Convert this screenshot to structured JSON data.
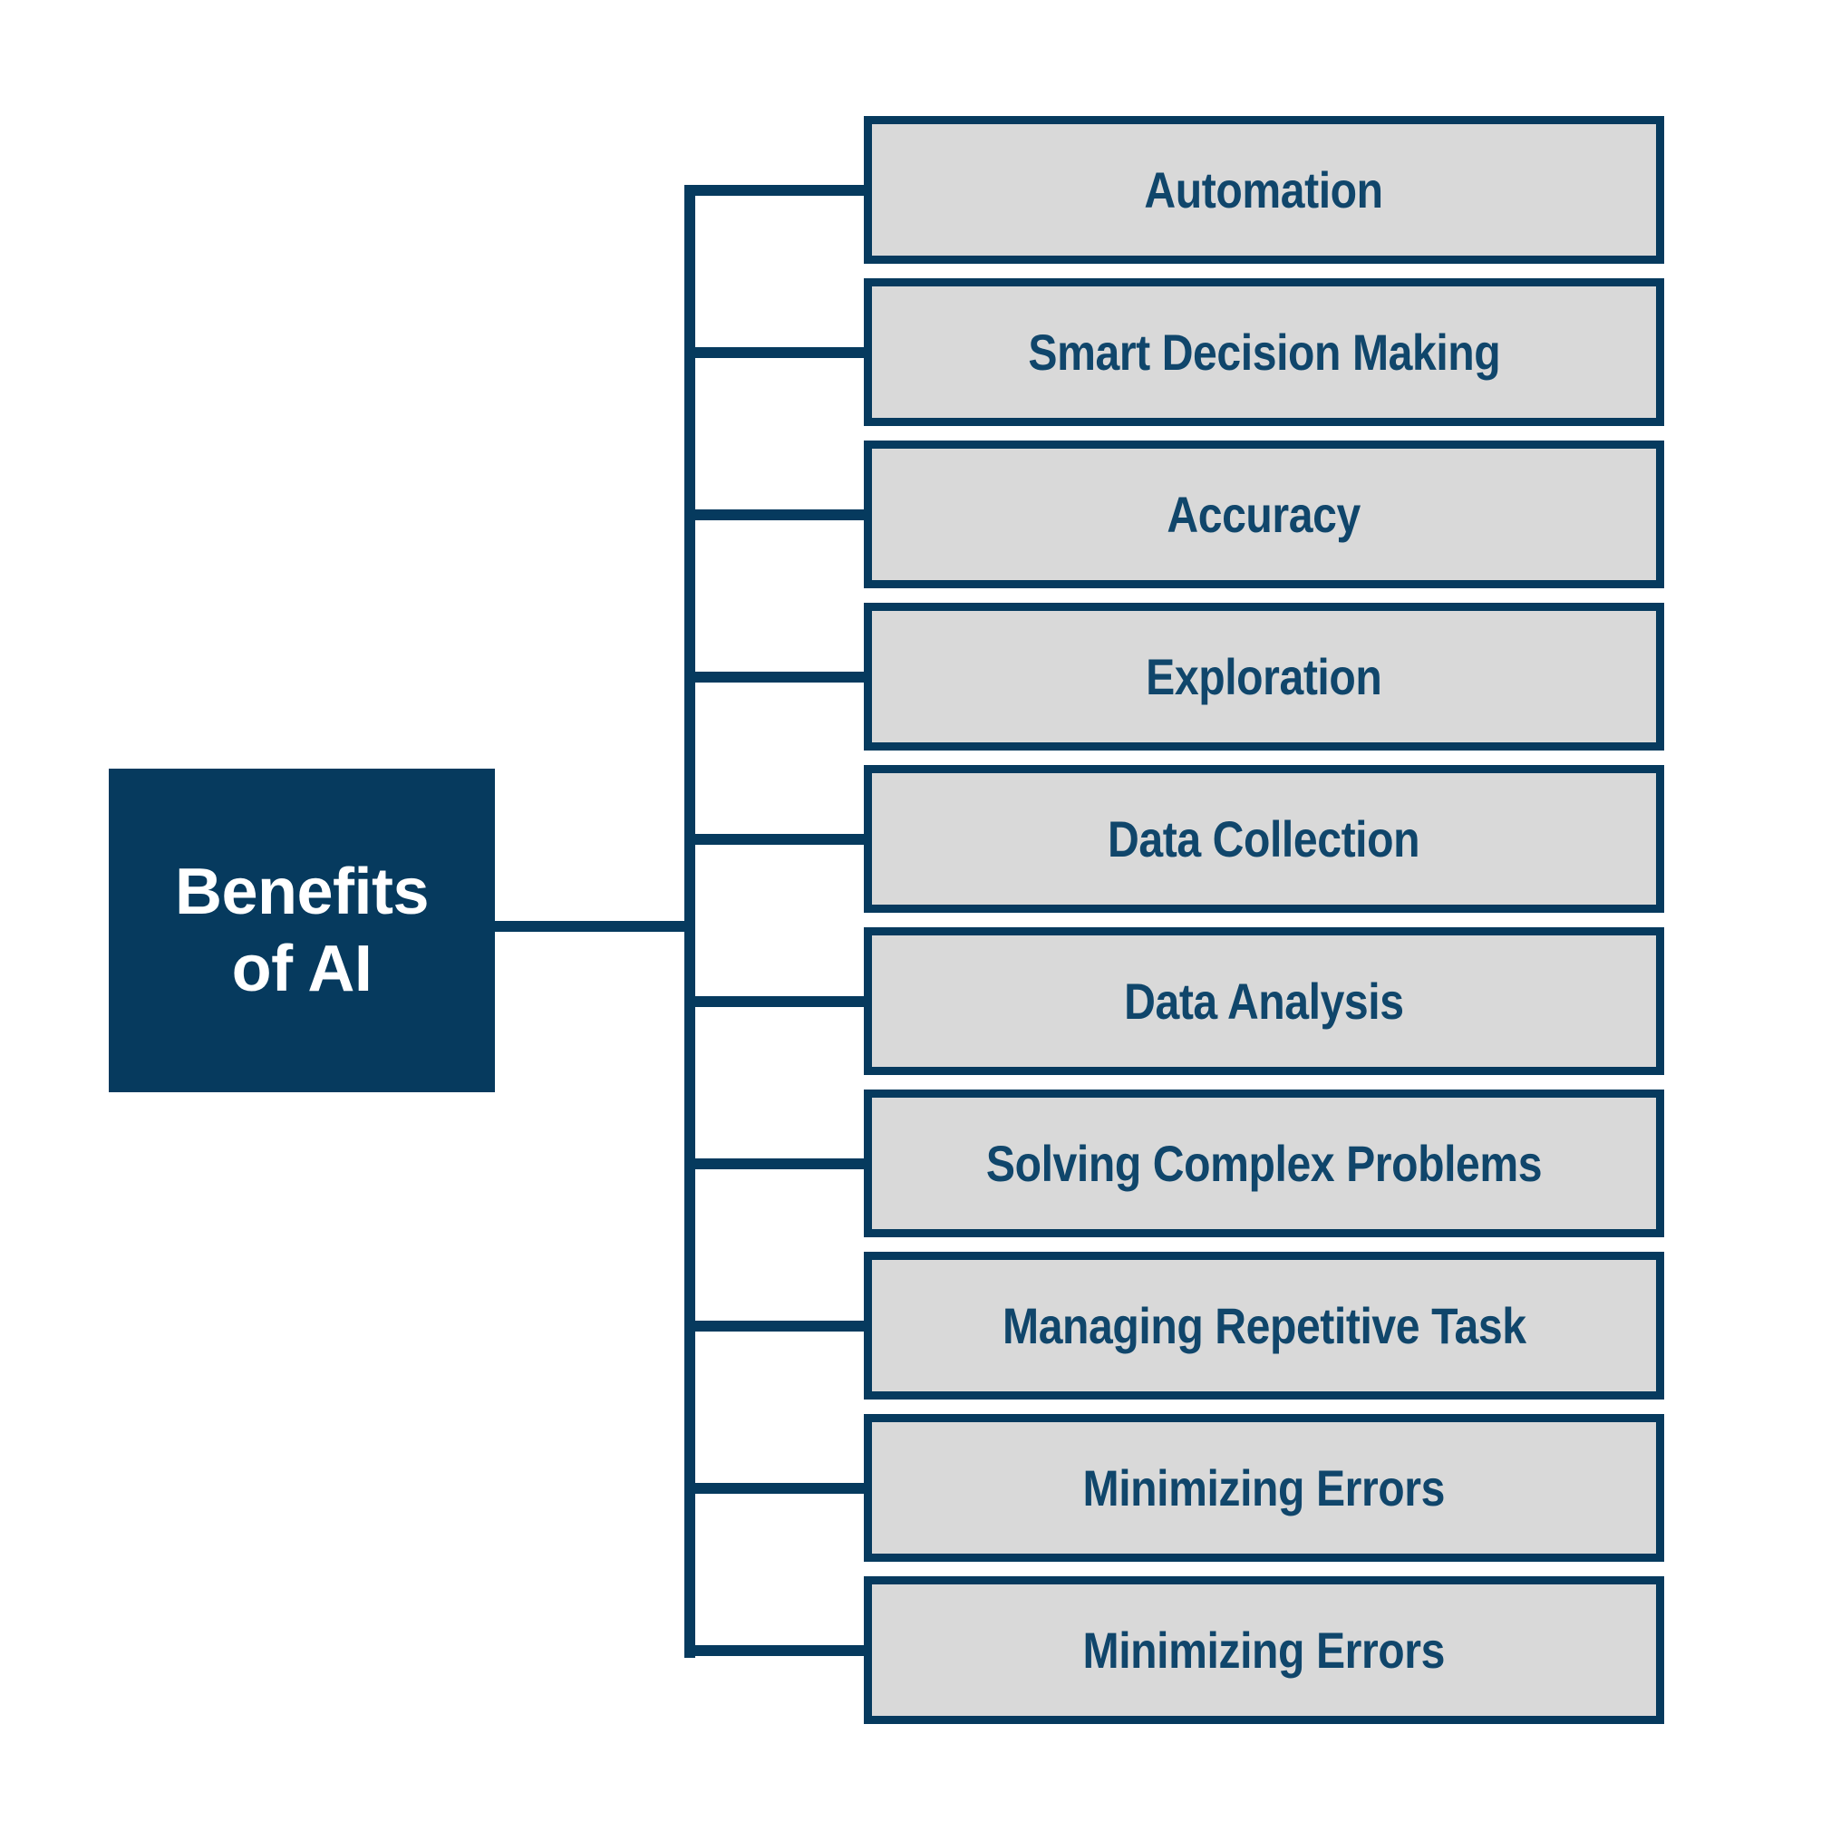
{
  "diagram": {
    "type": "mind-map",
    "title": "Benefits of AI",
    "root": {
      "label": "Benefits\nof AI",
      "text_color": "#ffffff",
      "fill_color": "#063a5e"
    },
    "style": {
      "accent_navy": "#063a5e",
      "box_fill": "#d9d9d9",
      "box_text": "#10466b",
      "background": "#ffffff"
    },
    "children": [
      {
        "label": "Automation"
      },
      {
        "label": "Smart Decision Making"
      },
      {
        "label": "Accuracy"
      },
      {
        "label": "Exploration"
      },
      {
        "label": "Data Collection"
      },
      {
        "label": "Data Analysis"
      },
      {
        "label": "Solving Complex Problems"
      },
      {
        "label": "Managing Repetitive Task"
      },
      {
        "label": "Minimizing Errors"
      }
    ],
    "children_extra": [
      {
        "label": "Minimizing Errors"
      }
    ]
  }
}
